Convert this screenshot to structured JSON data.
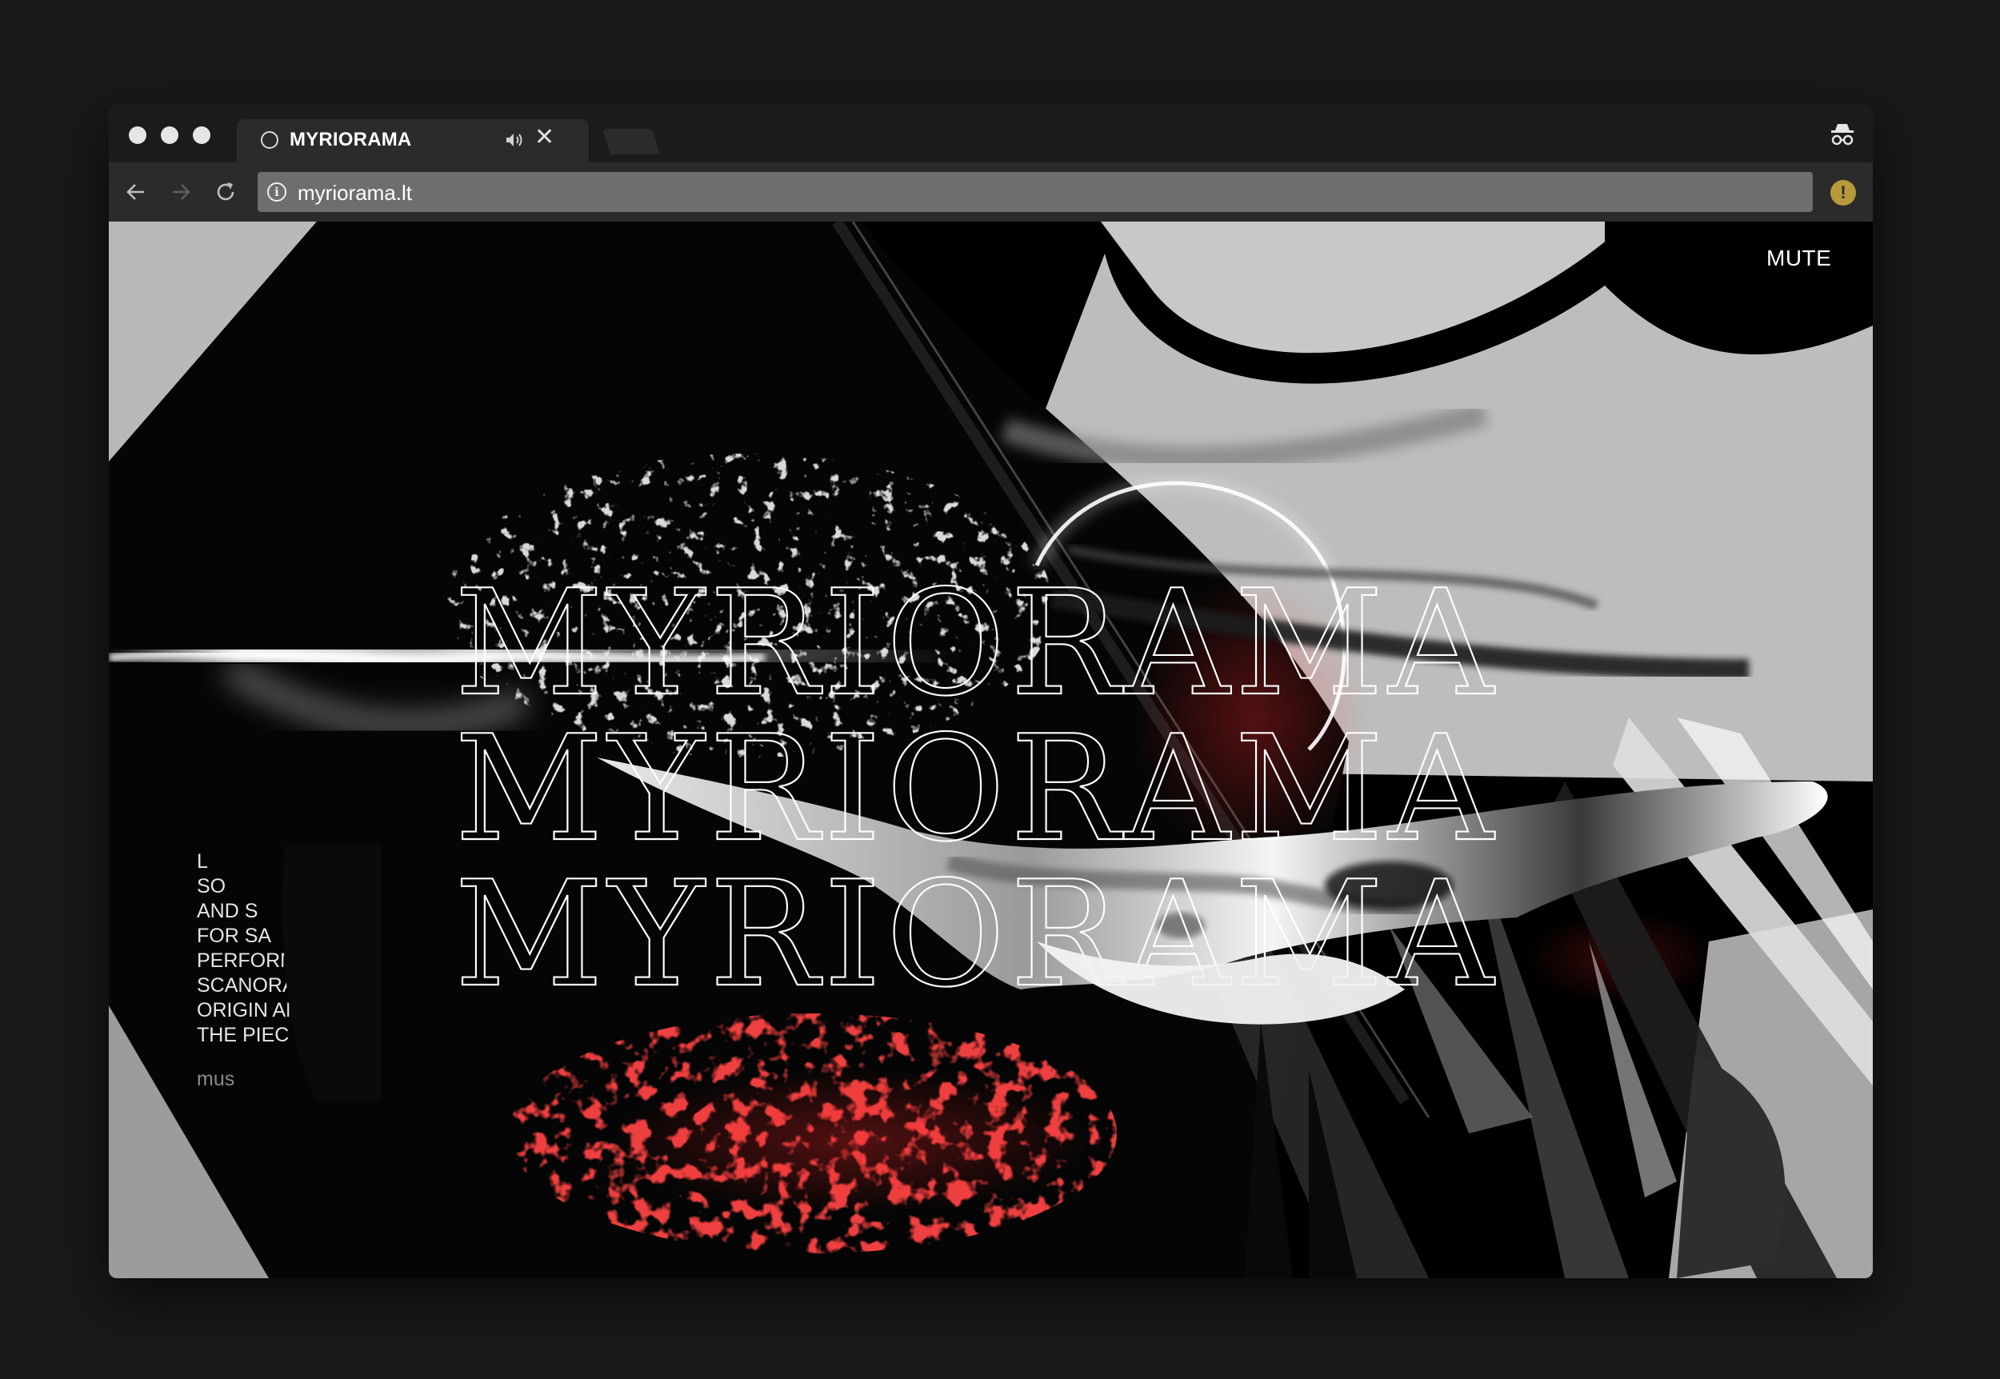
{
  "browser": {
    "tab": {
      "title": "MYRIORAMA",
      "audio_icon": "speaker-icon",
      "close_glyph": "✕"
    },
    "url": "myriorama.lt",
    "icons": {
      "back": "arrow-left-icon",
      "forward": "arrow-right-icon",
      "reload": "reload-icon",
      "site_info": "info-icon",
      "incognito": "incognito-icon",
      "extension": "alert-icon"
    }
  },
  "page": {
    "mute_label": "MUTE",
    "title_lines": [
      "MYRIORAMA",
      "MYRIORAMA",
      "MYRIORAMA"
    ],
    "side_text": [
      "L",
      "SO",
      "AND S",
      "FOR SA",
      "PERFORME",
      "SCANORAM",
      "ORIGIN AN",
      "THE PIEC"
    ],
    "side_link": "mus",
    "colors": {
      "accent_red": "#d11a1a",
      "background": "#000000",
      "text": "#ffffff"
    }
  }
}
